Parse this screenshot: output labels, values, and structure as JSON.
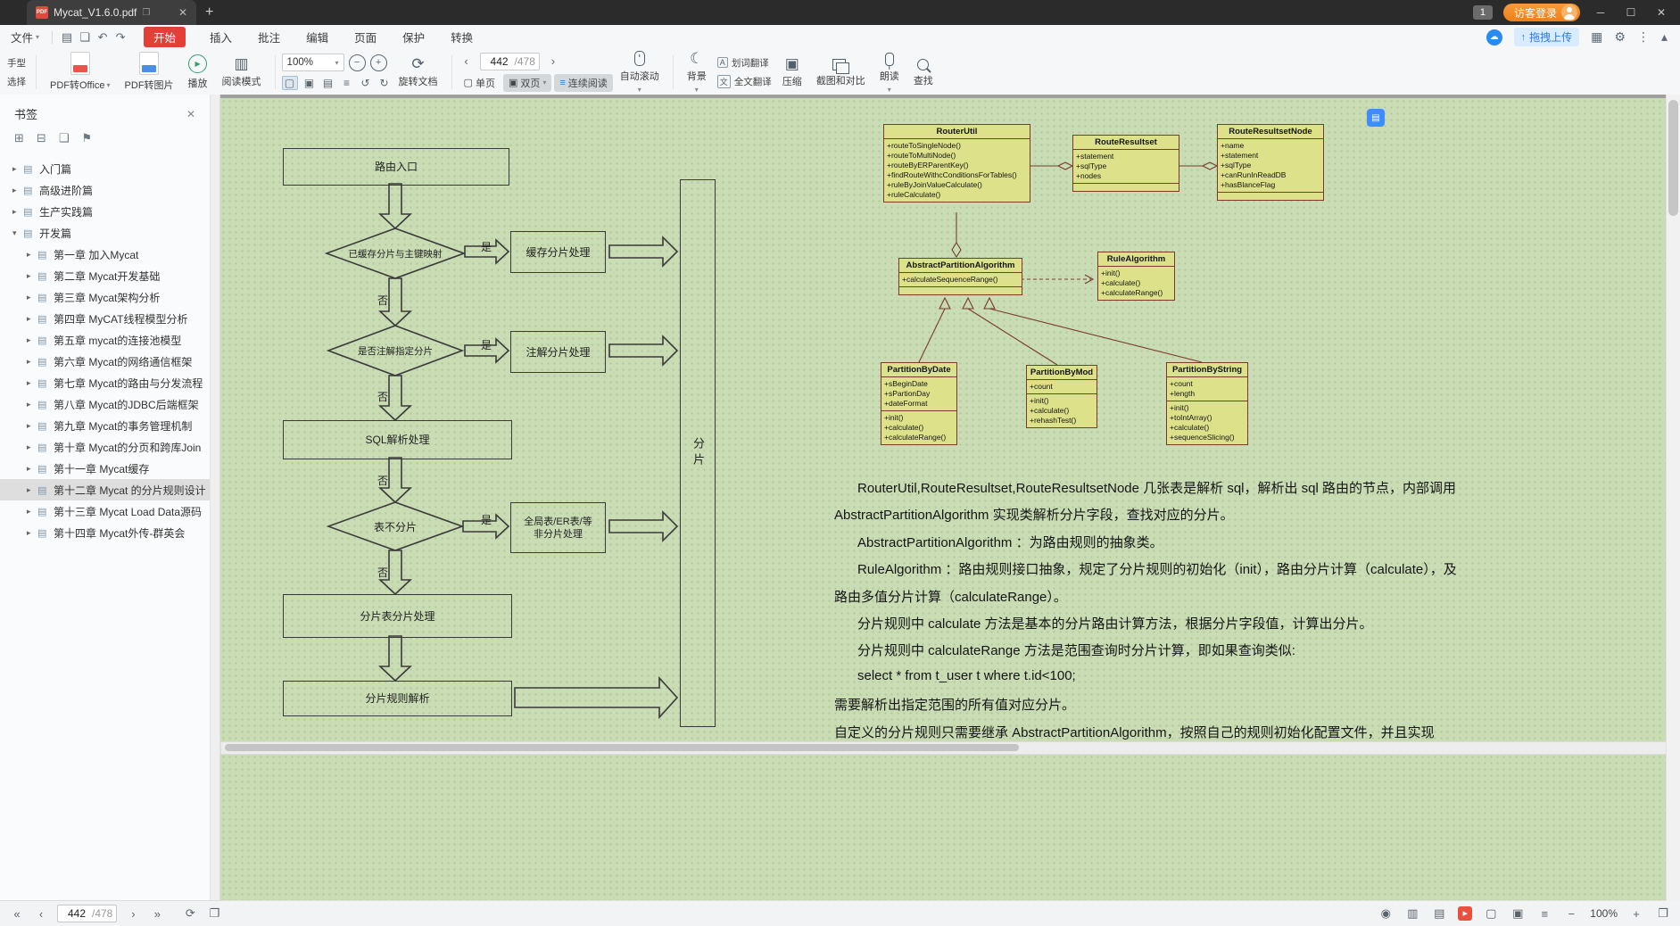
{
  "titlebar": {
    "tab_title": "Mycat_V1.6.0.pdf",
    "badge": "1",
    "login": "访客登录"
  },
  "menubar": {
    "file": "文件",
    "tabs": [
      "开始",
      "插入",
      "批注",
      "编辑",
      "页面",
      "保护",
      "转换"
    ],
    "drag_upload": "拖拽上传"
  },
  "toolbar": {
    "hand": "手型",
    "select": "选择",
    "pdf_to_office": "PDF转Office",
    "pdf_to_image": "PDF转图片",
    "play": "播放",
    "reading_mode": "阅读模式",
    "zoom": "100%",
    "rotate_doc": "旋转文档",
    "page_current": "442",
    "page_total": "/478",
    "single_page": "单页",
    "double_page": "双页",
    "continuous": "连续阅读",
    "auto_scroll": "自动滚动",
    "background": "背景",
    "word_translate": "划词翻译",
    "full_translate": "全文翻译",
    "compress": "压缩",
    "screenshot_compare": "截图和对比",
    "read_aloud": "朗读",
    "find": "查找"
  },
  "sidebar": {
    "title": "书签",
    "items": [
      {
        "label": "入门篇"
      },
      {
        "label": "高级进阶篇"
      },
      {
        "label": "生产实践篇"
      },
      {
        "label": "开发篇"
      },
      {
        "label": "第一章 加入Mycat"
      },
      {
        "label": "第二章 Mycat开发基础"
      },
      {
        "label": "第三章 Mycat架构分析"
      },
      {
        "label": "第四章 MyCAT线程模型分析"
      },
      {
        "label": "第五章 mycat的连接池模型"
      },
      {
        "label": "第六章 Mycat的网络通信框架"
      },
      {
        "label": "第七章 Mycat的路由与分发流程"
      },
      {
        "label": "第八章 Mycat的JDBC后端框架"
      },
      {
        "label": "第九章 Mycat的事务管理机制"
      },
      {
        "label": "第十章 Mycat的分页和跨库Join"
      },
      {
        "label": "第十一章 Mycat缓存"
      },
      {
        "label": "第十二章 Mycat 的分片规则设计"
      },
      {
        "label": "第十三章 Mycat Load Data源码"
      },
      {
        "label": "第十四章 Mycat外传-群英会"
      }
    ]
  },
  "flowchart": {
    "entry": "路由入口",
    "cached_diamond": "已缓存分片与主键映射",
    "annotation_diamond": "是否注解指定分片",
    "no_shard_diamond": "表不分片",
    "cache_box": "缓存分片处理",
    "annotation_box": "注解分片处理",
    "sql_box": "SQL解析处理",
    "global_box_line1": "全局表/ER表/等",
    "global_box_line2": "非分片处理",
    "table_box": "分片表分片处理",
    "rule_box": "分片规则解析",
    "shard_label": "分片",
    "yes": "是",
    "no": "否"
  },
  "uml": {
    "router_util": {
      "name": "RouterUtil",
      "methods": [
        "+routeToSingleNode()",
        "+routeToMultiNode()",
        "+routeByERParentKey()",
        "+findRouteWithcConditionsForTables()",
        "+ruleByJoinValueCalculate()",
        "+ruleCalculate()"
      ]
    },
    "route_resultset": {
      "name": "RouteResultset",
      "attrs": [
        "+statement",
        "+sqlType",
        "+nodes"
      ]
    },
    "route_resultset_node": {
      "name": "RouteResultsetNode",
      "attrs": [
        "+name",
        "+statement",
        "+sqlType",
        "+canRunInReadDB",
        "+hasBlanceFlag"
      ]
    },
    "abstract_partition": {
      "name": "AbstractPartitionAlgorithm",
      "methods": [
        "+calculateSequenceRange()"
      ]
    },
    "rule_algorithm": {
      "name": "RuleAlgorithm",
      "methods": [
        "+init()",
        "+calculate()",
        "+calculateRange()"
      ]
    },
    "partition_by_date": {
      "name": "PartitionByDate",
      "attrs": [
        "+sBeginDate",
        "+sPartionDay",
        "+dateFormat"
      ],
      "methods": [
        "+init()",
        "+calculate()",
        "+calculateRange()"
      ]
    },
    "partition_by_mod": {
      "name": "PartitionByMod",
      "attrs": [
        "+count"
      ],
      "methods": [
        "+init()",
        "+calculate()",
        "+rehashTest()"
      ]
    },
    "partition_by_string": {
      "name": "PartitionByString",
      "attrs": [
        "+count",
        "+length"
      ],
      "methods": [
        "+init()",
        "+toIntArray()",
        "+calculate()",
        "+sequenceSlicing()"
      ]
    }
  },
  "doc_text": [
    "RouterUtil,RouteResultset,RouteResultsetNode 几张表是解析 sql，解析出 sql 路由的节点，内部调用",
    "AbstractPartitionAlgorithm 实现类解析分片字段，查找对应的分片。",
    "AbstractPartitionAlgorithm ：为路由规则的抽象类。",
    "RuleAlgorithm ：路由规则接口抽象，规定了分片规则的初始化（init），路由分片计算（calculate），及",
    "路由多值分片计算（calculateRange）。",
    "分片规则中 calculate 方法是基本的分片路由计算方法，根据分片字段值，计算出分片。",
    "分片规则中 calculateRange 方法是范围查询时分片计算，即如果查询类似:",
    "select * from t_user t where t.id<100;",
    "需要解析出指定范围的所有值对应分片。",
    "自定义的分片规则只需要继承 AbstractPartitionAlgorithm，按照自己的规则初始化配置文件，并且实现"
  ],
  "statusbar": {
    "page_current": "442",
    "page_total": "/478",
    "zoom": "100%"
  }
}
